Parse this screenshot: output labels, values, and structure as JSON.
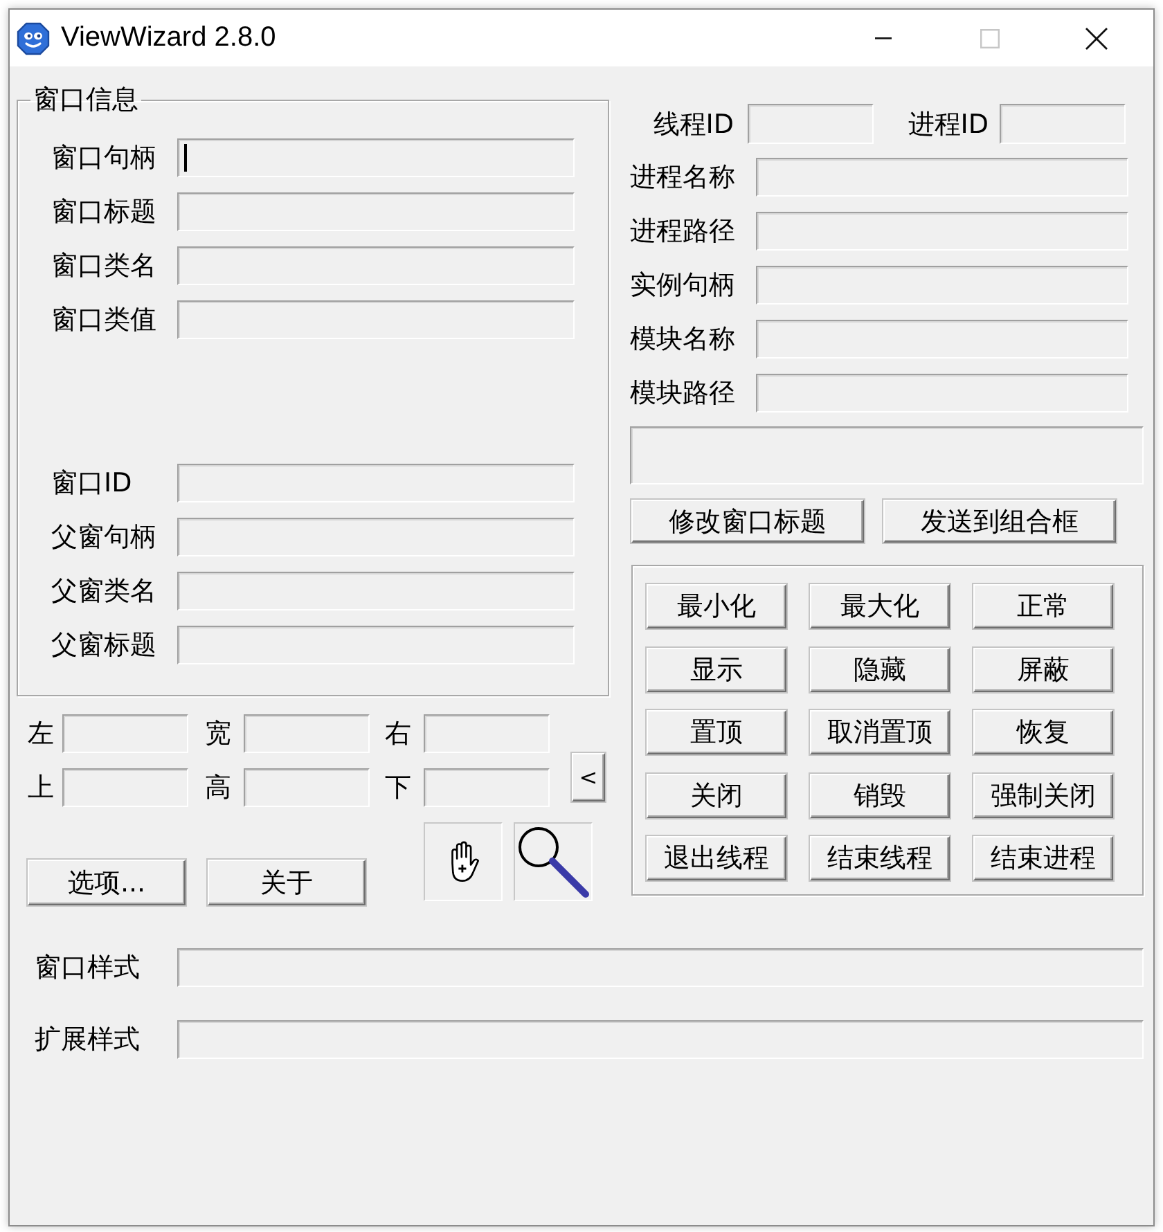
{
  "window": {
    "title": "ViewWizard 2.8.0",
    "controls": [
      {
        "kind": "minimize",
        "disabled": false
      },
      {
        "kind": "maximize",
        "disabled": true
      },
      {
        "kind": "close",
        "disabled": false
      }
    ]
  },
  "window_info": {
    "title": "窗口信息",
    "fields": [
      {
        "label": "窗口句柄",
        "focused": true
      },
      {
        "label": "窗口标题",
        "focused": false
      },
      {
        "label": "窗口类名",
        "focused": false
      },
      {
        "label": "窗口类值",
        "focused": false
      }
    ],
    "parent_fields": [
      {
        "label": "窗口ID",
        "focused": false
      },
      {
        "label": "父窗句柄",
        "focused": false
      },
      {
        "label": "父窗类名",
        "focused": false
      },
      {
        "label": "父窗标题",
        "focused": false
      }
    ]
  },
  "rect": {
    "fields": [
      {
        "label": "左"
      },
      {
        "label": "宽"
      },
      {
        "label": "右"
      },
      {
        "label": "上"
      },
      {
        "label": "高"
      },
      {
        "label": "下"
      }
    ],
    "toggle_button": "<"
  },
  "buttons": [
    "选项...",
    "关于"
  ],
  "finder_tools": [
    {
      "kind": "hand"
    },
    {
      "kind": "magnifier"
    }
  ],
  "process_info": {
    "id_fields": [
      {
        "label": "线程ID"
      },
      {
        "label": "进程ID"
      }
    ],
    "fields": [
      {
        "label": "进程名称"
      },
      {
        "label": "进程路径"
      },
      {
        "label": "实例句柄"
      },
      {
        "label": "模块名称"
      },
      {
        "label": "模块路径"
      }
    ],
    "actions": [
      "修改窗口标题",
      "发送到组合框"
    ]
  },
  "window_actions": [
    "最小化",
    "最大化",
    "正常",
    "显示",
    "隐藏",
    "屏蔽",
    "置顶",
    "取消置顶",
    "恢复",
    "关闭",
    "销毁",
    "强制关闭",
    "退出线程",
    "结束线程",
    "结束进程"
  ],
  "styles": [
    {
      "label": "窗口样式"
    },
    {
      "label": "扩展样式"
    }
  ]
}
